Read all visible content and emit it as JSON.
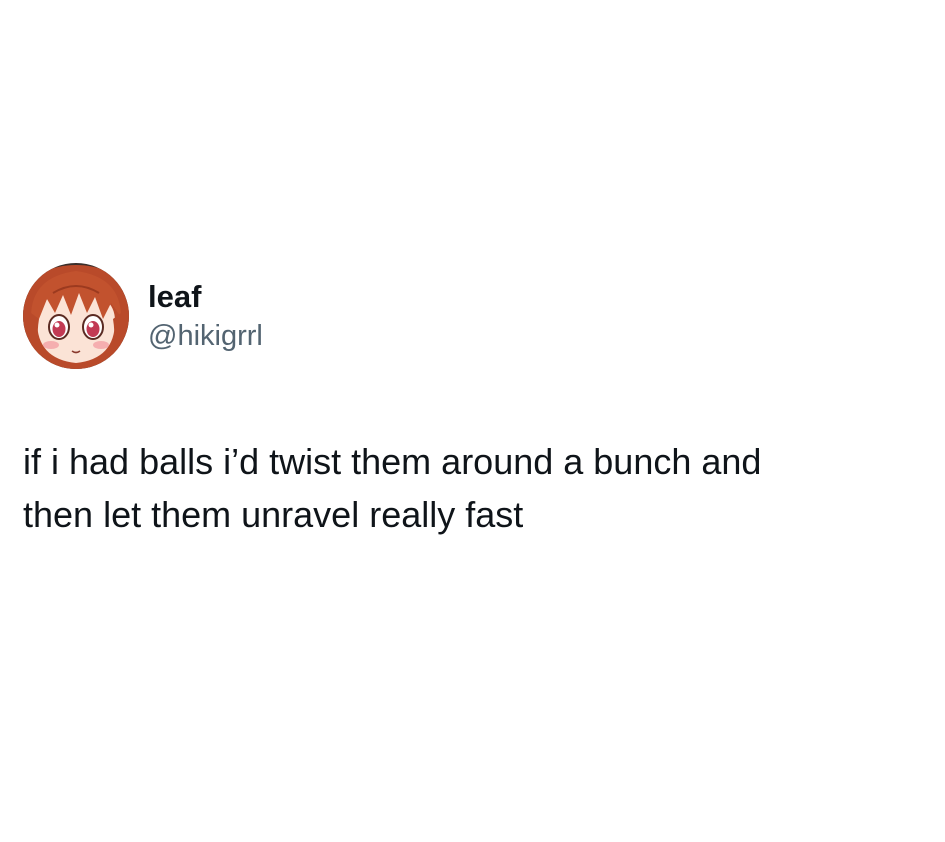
{
  "tweet": {
    "avatar": {
      "icon": "anime-girl-avatar",
      "hair_color": "#b94a2a",
      "skin_color": "#fbe3d6",
      "eye_color": "#c23a54",
      "blush_color": "#f3a4a8"
    },
    "display_name": "leaf",
    "handle": "@hikigrrl",
    "text": "if i had balls i’d twist them around a bunch and\nthen let them unravel really fast"
  }
}
